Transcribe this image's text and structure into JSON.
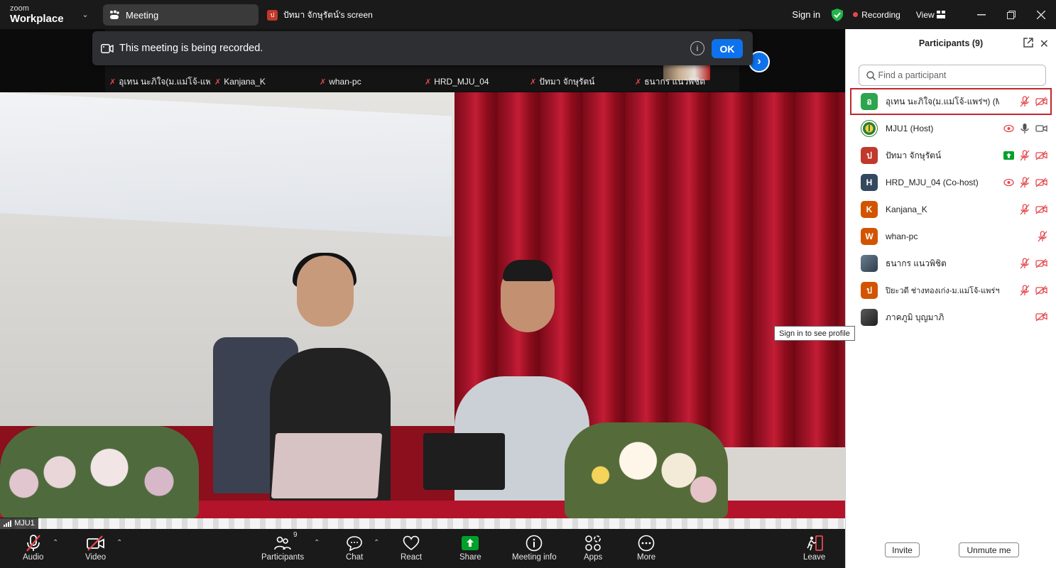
{
  "brand": {
    "small": "zoom",
    "big": "Workplace"
  },
  "tabs": {
    "meeting": "Meeting",
    "share_avatar": "ป",
    "share": "ปัทมา  จักษุรัตน์'s screen"
  },
  "header": {
    "sign_in": "Sign in",
    "recording": "Recording",
    "view": "View"
  },
  "banner": {
    "text": "This meeting is being recorded.",
    "info": "i",
    "ok": "OK"
  },
  "strip": {
    "names": [
      "อุเทน นะภิใจ(ม.แม่โจ้-แพ...",
      "Kanjana_K",
      "whan-pc",
      "HRD_MJU_04",
      "ปัทมา  จักษุรัตน์",
      "ธนากร แนวพิชิต"
    ]
  },
  "video": {
    "label": "MJU1",
    "tooltip": "Sign in to see profile"
  },
  "toolbar": {
    "audio": "Audio",
    "video": "Video",
    "participants": "Participants",
    "participants_count": "9",
    "chat": "Chat",
    "react": "React",
    "share": "Share",
    "meeting_info": "Meeting info",
    "apps": "Apps",
    "more": "More",
    "leave": "Leave"
  },
  "panel": {
    "title": "Participants (9)",
    "search_placeholder": "Find a participant",
    "participants": [
      {
        "initial": "อ",
        "name": "อุเทน นะภิใจ(ม.แม่โจ้-แพร่ฯ) (Me)",
        "color": "#2da44e"
      },
      {
        "initial": "",
        "name": "MJU1 (Host)",
        "color": "#2e7d32"
      },
      {
        "initial": "ป",
        "name": "ปัทมา  จักษุรัตน์",
        "color": "#c0392b"
      },
      {
        "initial": "H",
        "name": "HRD_MJU_04 (Co-host)",
        "color": "#34495e"
      },
      {
        "initial": "K",
        "name": "Kanjana_K",
        "color": "#d35400"
      },
      {
        "initial": "W",
        "name": "whan-pc",
        "color": "#d35400"
      },
      {
        "initial": "",
        "name": "ธนากร แนวพิชิต",
        "color": "#5d6d7e"
      },
      {
        "initial": "ป",
        "name": "ปิยะวดี ช่างทองเก่ง-ม.แม่โจ้-แพร่ฯ",
        "color": "#d35400"
      },
      {
        "initial": "",
        "name": "ภาคภูมิ บุญมาภิ",
        "color": "#4e4e4e"
      }
    ],
    "invite": "Invite",
    "unmute": "Unmute me"
  },
  "colors": {
    "accent": "#0e72ed",
    "muted": "#e5484d",
    "share": "#00a12b"
  }
}
